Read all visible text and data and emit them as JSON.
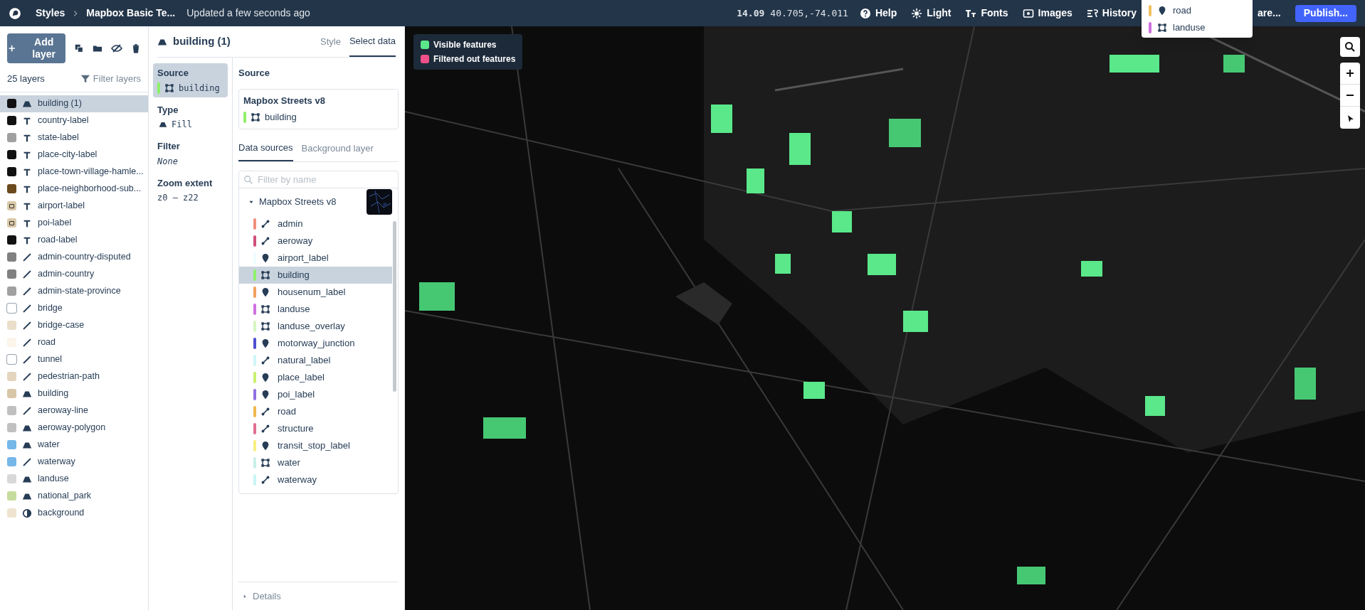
{
  "topbar": {
    "breadcrumb": "Styles",
    "style_name": "Mapbox Basic Te...",
    "status": "Updated a few seconds ago",
    "zoom": "14.09",
    "coords": "40.705,-74.011",
    "menu": [
      {
        "kind": "help",
        "label": "Help"
      },
      {
        "kind": "light",
        "label": "Light"
      },
      {
        "kind": "fonts",
        "label": "Fonts"
      },
      {
        "kind": "images",
        "label": "Images"
      },
      {
        "kind": "history",
        "label": "History"
      }
    ],
    "share": "are...",
    "publish": "Publish..."
  },
  "popup": [
    {
      "label": "road",
      "color": "#f0c060",
      "kind": "point"
    },
    {
      "label": "landuse",
      "color": "#d070e0",
      "kind": "polygon"
    }
  ],
  "layers_panel": {
    "add_label": "Add layer",
    "count": "25 layers",
    "filter": "Filter layers",
    "layers": [
      {
        "name": "building (1)",
        "color": "#111111",
        "kind": "fill",
        "selected": true
      },
      {
        "name": "country-label",
        "color": "#111111",
        "kind": "symbol",
        "selected": false
      },
      {
        "name": "state-label",
        "color": "#a0a0a0",
        "kind": "symbol",
        "selected": false
      },
      {
        "name": "place-city-label",
        "color": "#111111",
        "kind": "symbol",
        "selected": false
      },
      {
        "name": "place-town-village-hamle...",
        "color": "#111111",
        "kind": "symbol",
        "selected": false
      },
      {
        "name": "place-neighborhood-sub...",
        "color": "#6b4a1e",
        "kind": "symbol",
        "selected": false
      },
      {
        "name": "airport-label",
        "color": "#d9c9a8",
        "kind": "symbol",
        "selected": false,
        "image_swatch": true
      },
      {
        "name": "poi-label",
        "color": "#d9c9a8",
        "kind": "symbol",
        "selected": false,
        "image_swatch": true
      },
      {
        "name": "road-label",
        "color": "#111111",
        "kind": "symbol",
        "selected": false
      },
      {
        "name": "admin-country-disputed",
        "color": "#808080",
        "kind": "line",
        "selected": false
      },
      {
        "name": "admin-country",
        "color": "#808080",
        "kind": "line",
        "selected": false
      },
      {
        "name": "admin-state-province",
        "color": "#a0a0a0",
        "kind": "line",
        "selected": false
      },
      {
        "name": "bridge",
        "color": "#ffffff",
        "kind": "line",
        "selected": false
      },
      {
        "name": "bridge-case",
        "color": "#eadfcb",
        "kind": "line",
        "selected": false
      },
      {
        "name": "road",
        "color": "#fbf5ea",
        "kind": "line",
        "selected": false
      },
      {
        "name": "tunnel",
        "color": "#ffffff",
        "kind": "line",
        "selected": false
      },
      {
        "name": "pedestrian-path",
        "color": "#e3d5bd",
        "kind": "line",
        "selected": false
      },
      {
        "name": "building",
        "color": "#d8c6a8",
        "kind": "fill",
        "selected": false
      },
      {
        "name": "aeroway-line",
        "color": "#c0c0c0",
        "kind": "line",
        "selected": false
      },
      {
        "name": "aeroway-polygon",
        "color": "#c0c0c0",
        "kind": "fill",
        "selected": false
      },
      {
        "name": "water",
        "color": "#75b7e8",
        "kind": "fill",
        "selected": false
      },
      {
        "name": "waterway",
        "color": "#75b7e8",
        "kind": "line",
        "selected": false
      },
      {
        "name": "landuse",
        "color": "#d8d8d8",
        "kind": "fill",
        "selected": false
      },
      {
        "name": "national_park",
        "color": "#c5dc9c",
        "kind": "fill",
        "selected": false
      },
      {
        "name": "background",
        "color": "#efe3cf",
        "kind": "background",
        "selected": false
      }
    ]
  },
  "editor": {
    "title": "building (1)",
    "tabs": [
      {
        "label": "Style",
        "selected": false
      },
      {
        "label": "Select data",
        "selected": true
      }
    ],
    "props": [
      {
        "label": "Source",
        "value": "building",
        "color": "#8ef06a",
        "kind": "source",
        "selected": true
      },
      {
        "label": "Type",
        "value": "Fill",
        "kind": "type",
        "selected": false
      },
      {
        "label": "Filter",
        "value": "None",
        "kind": "italic",
        "selected": false
      },
      {
        "label": "Zoom extent",
        "value": "z0 — z22",
        "kind": "mono",
        "selected": false
      }
    ],
    "section_title": "Source",
    "current_source": {
      "name": "Mapbox Streets v8",
      "layer": "building",
      "color": "#8ef06a"
    },
    "source_tabs": [
      {
        "label": "Data sources",
        "selected": true
      },
      {
        "label": "Background layer",
        "selected": false
      }
    ],
    "filter_placeholder": "Filter by name",
    "tileset": "Mapbox Streets v8",
    "source_layers": [
      {
        "name": "admin",
        "color": "#f0907a",
        "kind": "line",
        "selected": false
      },
      {
        "name": "aeroway",
        "color": "#d0507a",
        "kind": "line",
        "selected": false
      },
      {
        "name": "airport_label",
        "color": "#eefcff",
        "kind": "point",
        "selected": false
      },
      {
        "name": "building",
        "color": "#8ef06a",
        "kind": "polygon",
        "selected": true
      },
      {
        "name": "housenum_label",
        "color": "#f0a060",
        "kind": "point",
        "selected": false
      },
      {
        "name": "landuse",
        "color": "#d070e0",
        "kind": "polygon",
        "selected": false
      },
      {
        "name": "landuse_overlay",
        "color": "#d8f5c0",
        "kind": "polygon",
        "selected": false
      },
      {
        "name": "motorway_junction",
        "color": "#5050d0",
        "kind": "point",
        "selected": false
      },
      {
        "name": "natural_label",
        "color": "#d0f5f8",
        "kind": "line",
        "selected": false
      },
      {
        "name": "place_label",
        "color": "#c8f070",
        "kind": "point",
        "selected": false
      },
      {
        "name": "poi_label",
        "color": "#9070e0",
        "kind": "point",
        "selected": false
      },
      {
        "name": "road",
        "color": "#f0b850",
        "kind": "line",
        "selected": false
      },
      {
        "name": "structure",
        "color": "#e07090",
        "kind": "line",
        "selected": false
      },
      {
        "name": "transit_stop_label",
        "color": "#f8f080",
        "kind": "point",
        "selected": false
      },
      {
        "name": "water",
        "color": "#c8f0e8",
        "kind": "polygon",
        "selected": false
      },
      {
        "name": "waterway",
        "color": "#c8f5f5",
        "kind": "line",
        "selected": false
      }
    ],
    "details": "Details"
  },
  "legend": [
    {
      "label": "Visible features",
      "color": "#5ae88a"
    },
    {
      "label": "Filtered out features",
      "color": "#f0508a"
    }
  ]
}
